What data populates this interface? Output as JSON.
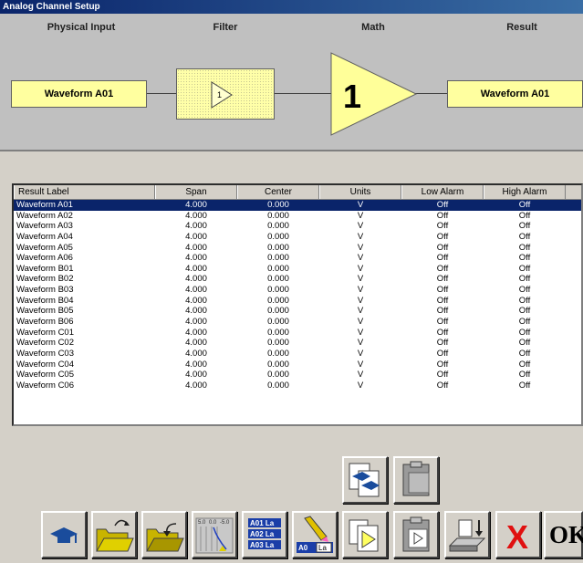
{
  "window": {
    "title": "Analog Channel Setup"
  },
  "diagram": {
    "headers": {
      "physical_input": "Physical Input",
      "filter": "Filter",
      "math": "Math",
      "result": "Result"
    },
    "input_label": "Waveform A01",
    "filter_value": "1",
    "math_value": "1",
    "result_label": "Waveform A01",
    "colors": {
      "block_fill": "#ffff9f",
      "math_fill": "#ffff99"
    }
  },
  "table": {
    "columns": [
      "Result Label",
      "Span",
      "Center",
      "Units",
      "Low Alarm",
      "High Alarm"
    ],
    "selected_index": 0,
    "rows": [
      [
        "Waveform A01",
        "4.000",
        "0.000",
        "V",
        "Off",
        "Off"
      ],
      [
        "Waveform A02",
        "4.000",
        "0.000",
        "V",
        "Off",
        "Off"
      ],
      [
        "Waveform A03",
        "4.000",
        "0.000",
        "V",
        "Off",
        "Off"
      ],
      [
        "Waveform A04",
        "4.000",
        "0.000",
        "V",
        "Off",
        "Off"
      ],
      [
        "Waveform A05",
        "4.000",
        "0.000",
        "V",
        "Off",
        "Off"
      ],
      [
        "Waveform A06",
        "4.000",
        "0.000",
        "V",
        "Off",
        "Off"
      ],
      [
        "Waveform B01",
        "4.000",
        "0.000",
        "V",
        "Off",
        "Off"
      ],
      [
        "Waveform B02",
        "4.000",
        "0.000",
        "V",
        "Off",
        "Off"
      ],
      [
        "Waveform B03",
        "4.000",
        "0.000",
        "V",
        "Off",
        "Off"
      ],
      [
        "Waveform B04",
        "4.000",
        "0.000",
        "V",
        "Off",
        "Off"
      ],
      [
        "Waveform B05",
        "4.000",
        "0.000",
        "V",
        "Off",
        "Off"
      ],
      [
        "Waveform B06",
        "4.000",
        "0.000",
        "V",
        "Off",
        "Off"
      ],
      [
        "Waveform C01",
        "4.000",
        "0.000",
        "V",
        "Off",
        "Off"
      ],
      [
        "Waveform C02",
        "4.000",
        "0.000",
        "V",
        "Off",
        "Off"
      ],
      [
        "Waveform C03",
        "4.000",
        "0.000",
        "V",
        "Off",
        "Off"
      ],
      [
        "Waveform C04",
        "4.000",
        "0.000",
        "V",
        "Off",
        "Off"
      ],
      [
        "Waveform C05",
        "4.000",
        "0.000",
        "V",
        "Off",
        "Off"
      ],
      [
        "Waveform C06",
        "4.000",
        "0.000",
        "V",
        "Off",
        "Off"
      ]
    ]
  },
  "toolbar": {
    "icons": [
      "copy-icon",
      "paste-icon",
      "help-icon",
      "open-file-icon",
      "save-file-icon",
      "scale-icon",
      "label-list-icon",
      "label-edit-icon",
      "filter-icon",
      "math-icon",
      "export-icon",
      "cancel-icon",
      "ok-icon"
    ],
    "scale_ticks": [
      "5.0",
      "0.0",
      "-5.0"
    ],
    "label_list": [
      "A01 La",
      "A02 La",
      "A03 La"
    ],
    "label_edit_tag": "A0",
    "label_edit_tag2": "La",
    "filter_value": "1",
    "ok_label": "OK",
    "cancel_glyph": "X"
  }
}
